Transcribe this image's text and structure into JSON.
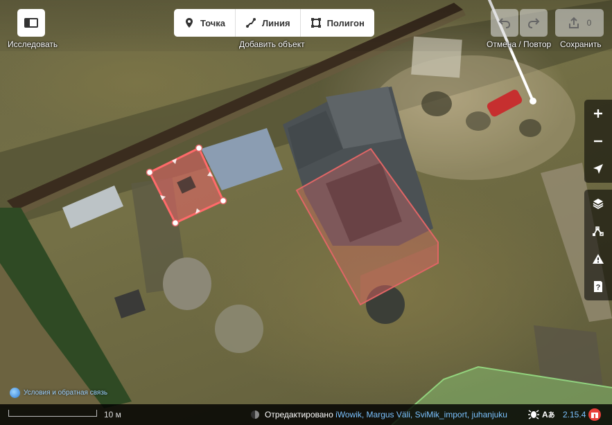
{
  "toolbar": {
    "explore_label": "Исследовать",
    "add_feature_label": "Добавить объект",
    "point_label": "Точка",
    "line_label": "Линия",
    "polygon_label": "Полигон",
    "undo_redo_label": "Отмена / Повтор",
    "save_label": "Сохранить",
    "save_count": "0"
  },
  "map_controls": {
    "zoom_in": "+",
    "zoom_out": "−"
  },
  "footer": {
    "terms_link": "Условия и обратная связь",
    "scale_label": "10 м",
    "edited_by_prefix": "Отредактировано",
    "editors": "iWowik, Margus Väli, SviMik_import, juhanjuku",
    "version": "2.15.4",
    "language_glyph": "A"
  },
  "colors": {
    "accent_blue": "#7bc2ff",
    "selection_red": "#e06666",
    "issue_badge": "#e8403a"
  }
}
